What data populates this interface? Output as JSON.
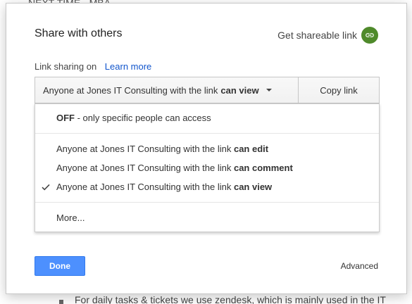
{
  "background": {
    "top_text": "NEXT TIME - MBA",
    "bottom_text": "For daily tasks & tickets we use zendesk, which is mainly used in the IT"
  },
  "dialog": {
    "title": "Share with others",
    "get_link_label": "Get shareable link",
    "link_sharing_label": "Link sharing on",
    "learn_more": "Learn more",
    "select": {
      "prefix": "Anyone at Jones IT Consulting with the link",
      "bold": "can view"
    },
    "copy_link": "Copy link",
    "menu": {
      "off": {
        "bold": "OFF",
        "rest": " - only specific people can access"
      },
      "options": [
        {
          "prefix": "Anyone at Jones IT Consulting with the link ",
          "bold": "can edit",
          "checked": false
        },
        {
          "prefix": "Anyone at Jones IT Consulting with the link ",
          "bold": "can comment",
          "checked": false
        },
        {
          "prefix": "Anyone at Jones IT Consulting with the link ",
          "bold": "can view",
          "checked": true
        }
      ],
      "more": "More..."
    },
    "done": "Done",
    "advanced": "Advanced"
  },
  "colors": {
    "accent_blue": "#4d90fe",
    "link_blue": "#1155cc",
    "link_icon_green": "#4f8a2b"
  }
}
